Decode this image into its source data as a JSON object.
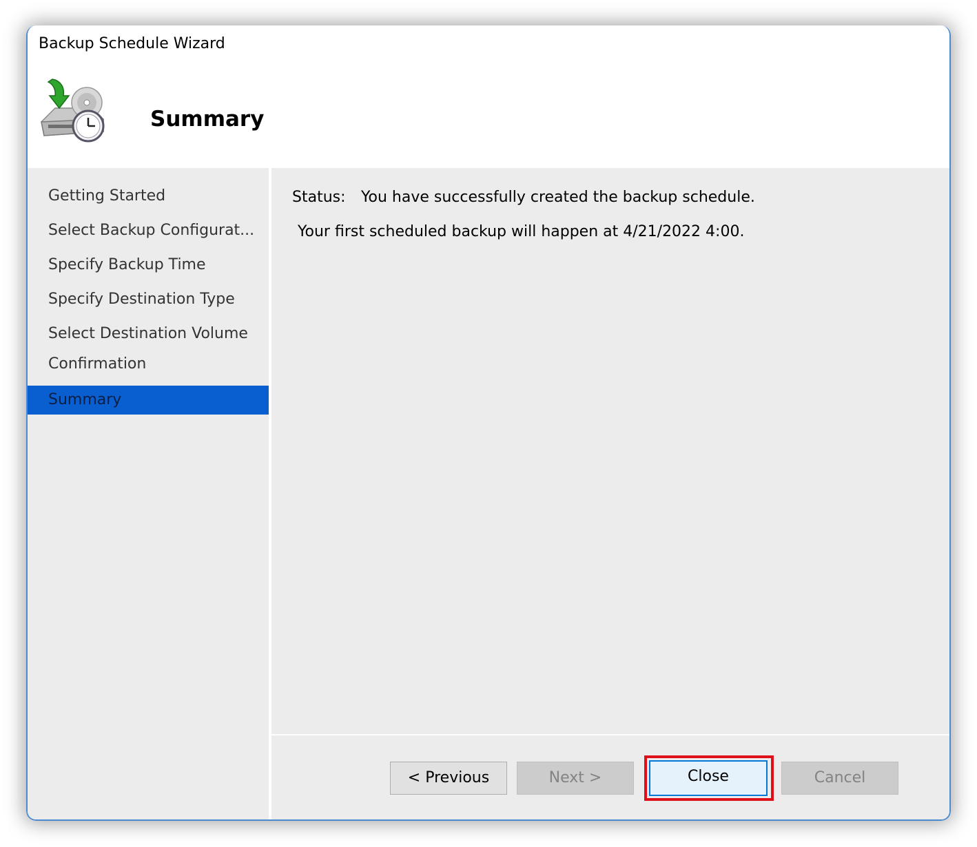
{
  "window": {
    "title": "Backup Schedule Wizard"
  },
  "header": {
    "icon": "backup-schedule-icon",
    "title": "Summary"
  },
  "sidebar": {
    "items": [
      {
        "label": "Getting Started",
        "active": false
      },
      {
        "label": "Select Backup Configurat...",
        "active": false
      },
      {
        "label": "Specify Backup Time",
        "active": false
      },
      {
        "label": "Specify Destination Type",
        "active": false
      },
      {
        "label": "Select Destination Volume",
        "active": false
      },
      {
        "label": "Confirmation",
        "active": false
      },
      {
        "label": "Summary",
        "active": true
      }
    ]
  },
  "content": {
    "status_label": "Status:",
    "status_text": "You have successfully created the backup schedule.",
    "info_text": "Your first scheduled backup will happen at 4/21/2022 4:00."
  },
  "buttons": {
    "previous": {
      "label": "< Previous",
      "enabled": true
    },
    "next": {
      "label": "Next >",
      "enabled": false
    },
    "close": {
      "label": "Close",
      "enabled": true,
      "highlighted": true
    },
    "cancel": {
      "label": "Cancel",
      "enabled": false
    }
  },
  "colors": {
    "selection": "#0a5fd0",
    "highlight_box": "#e0101a",
    "focus_border": "#0078d7"
  }
}
